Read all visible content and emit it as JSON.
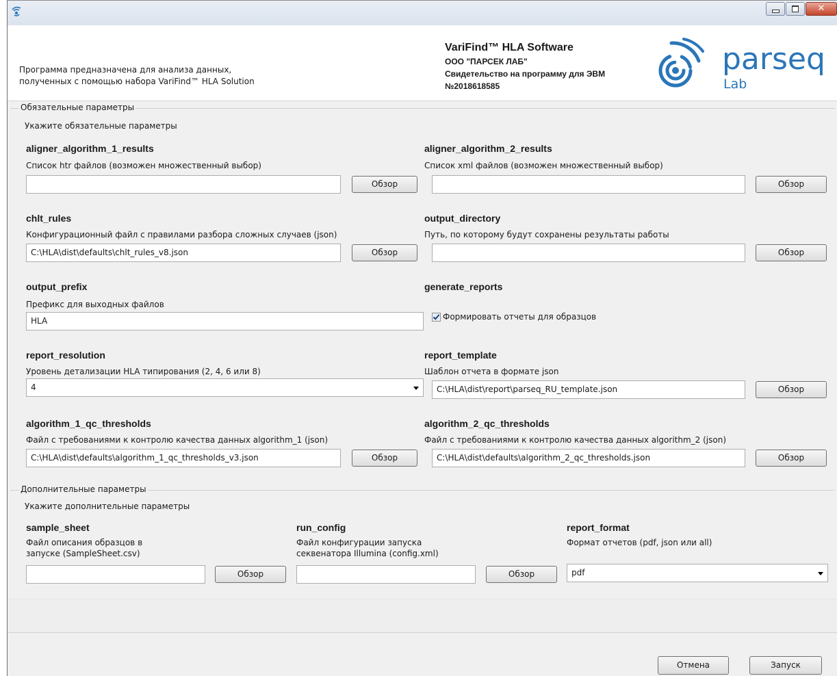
{
  "header": {
    "description_line1": "Программа предназначена для анализа данных,",
    "description_line2": "полученных с помощью набора VariFind™ HLA Solution",
    "product": "VariFind™ HLA Software",
    "company": "ООО \"ПАРСЕК ЛАБ\"",
    "certificate": "Свидетельство на программу для ЭВМ",
    "certificate_no": "№2018618585",
    "logo_word1": "parseq",
    "logo_word2": "Lab"
  },
  "required": {
    "group_title": "Обязательные параметры",
    "hint": "Укажите обязательные параметры",
    "params": {
      "a1": {
        "name": "aligner_algorithm_1_results",
        "desc": "Список htr файлов (возможен множественный выбор)",
        "value": "",
        "button": "Обзор"
      },
      "a2": {
        "name": "aligner_algorithm_2_results",
        "desc": "Список xml файлов (возможен множественный выбор)",
        "value": "",
        "button": "Обзор"
      },
      "chlt": {
        "name": "chlt_rules",
        "desc": "Конфигурационный файл с правилами разбора сложных случаев (json)",
        "value": "C:\\HLA\\dist\\defaults\\chlt_rules_v8.json",
        "button": "Обзор"
      },
      "outdir": {
        "name": "output_directory",
        "desc": "Путь, по которому будут сохранены результаты работы",
        "value": "",
        "button": "Обзор"
      },
      "prefix": {
        "name": "output_prefix",
        "desc": "Префикс для выходных файлов",
        "value": "HLA"
      },
      "genrep": {
        "name": "generate_reports",
        "checkbox_label": "Формировать отчеты для образцов",
        "checked": true
      },
      "resolution": {
        "name": "report_resolution",
        "desc": "Уровень детализации HLA типирования (2, 4, 6 или 8)",
        "value": "4"
      },
      "template": {
        "name": "report_template",
        "desc": "Шаблон отчета в формате json",
        "value": "C:\\HLA\\dist\\report\\parseq_RU_template.json",
        "button": "Обзор"
      },
      "qc1": {
        "name": "algorithm_1_qc_thresholds",
        "desc": "Файл с требованиями к контролю качества данных algorithm_1 (json)",
        "value": "C:\\HLA\\dist\\defaults\\algorithm_1_qc_thresholds_v3.json",
        "button": "Обзор"
      },
      "qc2": {
        "name": "algorithm_2_qc_thresholds",
        "desc": "Файл с требованиями к контролю качества данных algorithm_2 (json)",
        "value": "C:\\HLA\\dist\\defaults\\algorithm_2_qc_thresholds.json",
        "button": "Обзор"
      }
    }
  },
  "optional": {
    "group_title": "Дополнительные параметры",
    "hint": "Укажите дополнительные параметры",
    "params": {
      "sheet": {
        "name": "sample_sheet",
        "desc_line1": "Файл описания образцов в",
        "desc_line2": "запуске (SampleSheet.csv)",
        "value": "",
        "button": "Обзор"
      },
      "runcfg": {
        "name": "run_config",
        "desc_line1": "Файл конфигурации запуска",
        "desc_line2": "секвенатора Illumina (config.xml)",
        "value": "",
        "button": "Обзор"
      },
      "format": {
        "name": "report_format",
        "desc": "Формат отчетов (pdf, json или all)",
        "value": "pdf"
      }
    }
  },
  "footer": {
    "cancel": "Отмена",
    "run": "Запуск"
  },
  "colors": {
    "logo_blue": "#2a76b9",
    "window_bg": "#f0f0f0"
  }
}
